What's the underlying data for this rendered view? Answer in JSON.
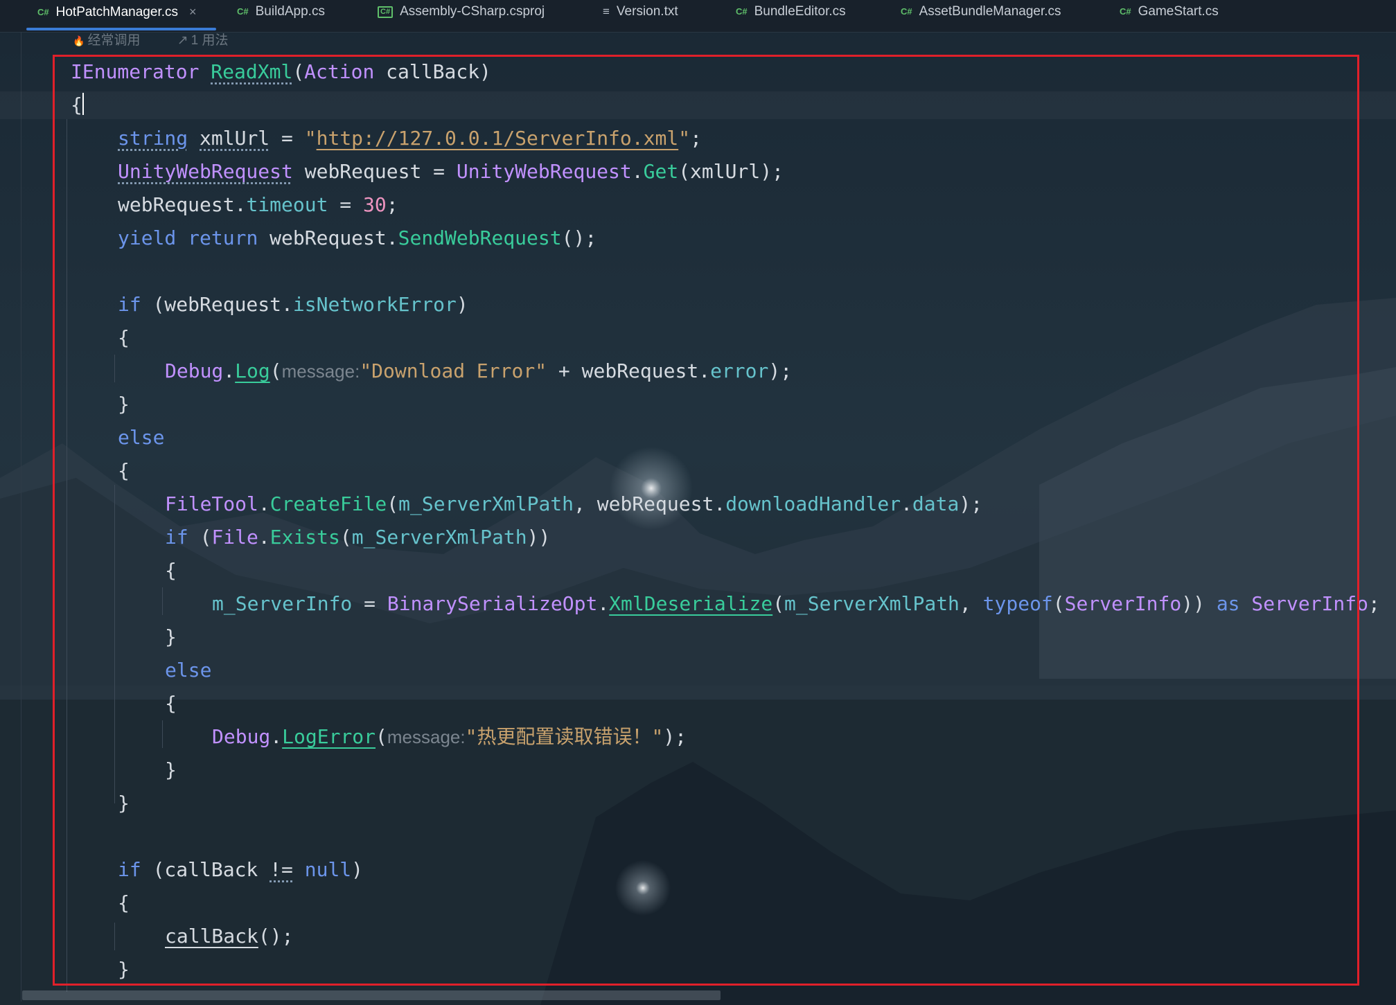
{
  "tabs": [
    {
      "label": "HotPatchManager.cs",
      "icon": "csharp-icon"
    },
    {
      "label": "BuildApp.cs",
      "icon": "csharp-icon"
    },
    {
      "label": "Assembly-CSharp.csproj",
      "icon": "csproj-icon"
    },
    {
      "label": "Version.txt",
      "icon": "text-file-icon"
    },
    {
      "label": "BundleEditor.cs",
      "icon": "csharp-icon"
    },
    {
      "label": "AssetBundleManager.cs",
      "icon": "csharp-icon"
    },
    {
      "label": "GameStart.cs",
      "icon": "csharp-icon"
    }
  ],
  "icon_glyphs": {
    "csharp": "C#",
    "csproj": "C#",
    "text_file": "≡",
    "close": "×",
    "flame": "🔥",
    "usages": "↗"
  },
  "hints": {
    "frequent": "经常调用",
    "usages": "1 用法"
  },
  "code": {
    "l1": {
      "t1": "IEnumerator",
      "t2": "ReadXml",
      "t3": "(",
      "t4": "Action",
      "t5": " callBack)"
    },
    "l2": {
      "t1": "{"
    },
    "l3": {
      "t1": "string",
      "t2": " ",
      "t3": "xmlUrl",
      "t4": " = ",
      "t5": "\"",
      "t6": "http://127.0.0.1/ServerInfo.xml",
      "t7": "\"",
      "t8": ";"
    },
    "l4": {
      "t1": "UnityWebRequest",
      "t2": " webRequest = ",
      "t3": "UnityWebRequest",
      "t4": ".",
      "t5": "Get",
      "t6": "(xmlUrl);"
    },
    "l5": {
      "t1": "webRequest.",
      "t2": "timeout",
      "t3": " = ",
      "t4": "30",
      "t5": ";"
    },
    "l6": {
      "t1": "yield",
      "t2": " ",
      "t3": "return",
      "t4": " webRequest.",
      "t5": "SendWebRequest",
      "t6": "();"
    },
    "l7": {
      "t1": "if",
      "t2": " (webRequest.",
      "t3": "isNetworkError",
      "t4": ")"
    },
    "l8": {
      "t1": "{"
    },
    "l9": {
      "t1": "Debug",
      "t2": ".",
      "t3": "Log",
      "t4": "(",
      "t5": "message:",
      "t6": "\"Download Error\"",
      "t7": " + webRequest.",
      "t8": "error",
      "t9": ");"
    },
    "l10": {
      "t1": "}"
    },
    "l11": {
      "t1": "else"
    },
    "l12": {
      "t1": "{"
    },
    "l13": {
      "t1": "FileTool",
      "t2": ".",
      "t3": "CreateFile",
      "t4": "(",
      "t5": "m_ServerXmlPath",
      "t6": ", webRequest.",
      "t7": "downloadHandler",
      "t8": ".",
      "t9": "data",
      "t10": ");"
    },
    "l14": {
      "t1": "if",
      "t2": " (",
      "t3": "File",
      "t4": ".",
      "t5": "Exists",
      "t6": "(",
      "t7": "m_ServerXmlPath",
      "t8": "))"
    },
    "l15": {
      "t1": "{"
    },
    "l16": {
      "t1": "m_ServerInfo",
      "t2": " = ",
      "t3": "BinarySerializeOpt",
      "t4": ".",
      "t5": "XmlDeserialize",
      "t6": "(",
      "t7": "m_ServerXmlPath",
      "t8": ", ",
      "t9": "typeof",
      "t10": "(",
      "t11": "ServerInfo",
      "t12": ")) ",
      "t13": "as",
      "t14": " ",
      "t15": "ServerInfo",
      "t16": ";"
    },
    "l17": {
      "t1": "}"
    },
    "l18": {
      "t1": "else"
    },
    "l19": {
      "t1": "{"
    },
    "l20": {
      "t1": "Debug",
      "t2": ".",
      "t3": "LogError",
      "t4": "(",
      "t5": "message:",
      "t6": "\"热更配置读取错误！\"",
      "t7": ");"
    },
    "l21": {
      "t1": "}"
    },
    "l22": {
      "t1": "}"
    },
    "l23": {
      "t1": "if",
      "t2": " (callBack ",
      "t3": "!=",
      "t4": " ",
      "t5": "null",
      "t6": ")"
    },
    "l24": {
      "t1": "{"
    },
    "l25": {
      "t1": "callBack",
      "t2": "();"
    },
    "l26": {
      "t1": "}"
    }
  },
  "colors": {
    "keyword": "#6c95eb",
    "type": "#c191ff",
    "method": "#39cc9b",
    "property": "#66c3cc",
    "string": "#c9a26d",
    "number": "#ed94c0",
    "highlight_box": "#e0202a",
    "active_tab_underline": "#3a7bd5"
  }
}
